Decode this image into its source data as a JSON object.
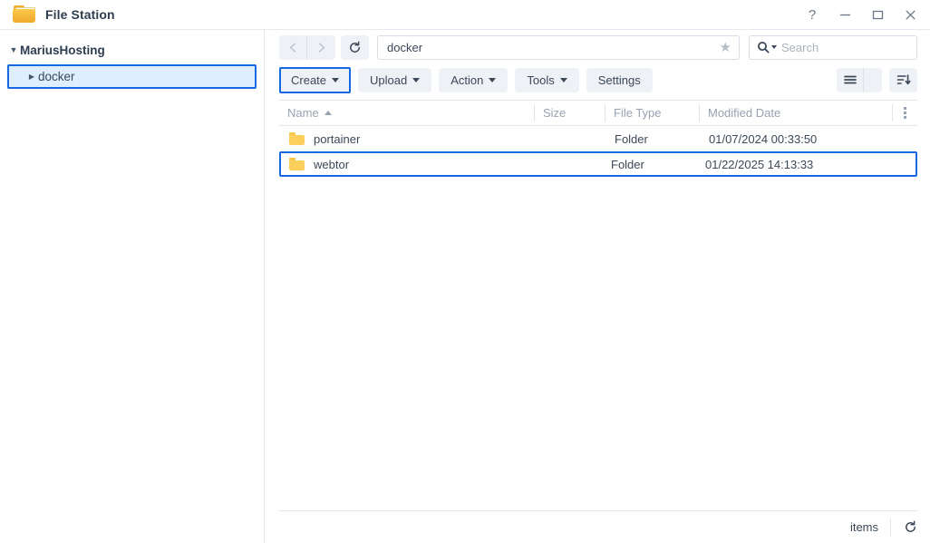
{
  "titlebar": {
    "app_title": "File Station",
    "app_icon": "folder-icon",
    "controls": {
      "help": "?",
      "minimize": "minimize-icon",
      "maximize": "maximize-icon",
      "close": "close-icon"
    }
  },
  "sidebar": {
    "root": {
      "label": "MariusHosting",
      "expanded": true
    },
    "items": [
      {
        "label": "docker",
        "selected": true,
        "expanded": false
      }
    ]
  },
  "navbar": {
    "back_icon": "chevron-left-icon",
    "forward_icon": "chevron-right-icon",
    "refresh_icon": "refresh-icon",
    "path_value": "docker",
    "favorite_icon": "star-icon",
    "search_icon": "search-icon",
    "search_placeholder": "Search",
    "search_value": ""
  },
  "toolbar": {
    "buttons": [
      {
        "label": "Create",
        "has_caret": true,
        "focused": true
      },
      {
        "label": "Upload",
        "has_caret": true,
        "focused": false
      },
      {
        "label": "Action",
        "has_caret": true,
        "focused": false
      },
      {
        "label": "Tools",
        "has_caret": true,
        "focused": false
      },
      {
        "label": "Settings",
        "has_caret": false,
        "focused": false
      }
    ],
    "view_mode_icon": "list-view-icon",
    "view_mode_caret_icon": "chevron-down-icon",
    "sort_icon": "sort-descending-icon"
  },
  "filelist": {
    "columns": [
      {
        "key": "name",
        "label": "Name",
        "sorted": "asc"
      },
      {
        "key": "size",
        "label": "Size"
      },
      {
        "key": "type",
        "label": "File Type"
      },
      {
        "key": "date",
        "label": "Modified Date"
      }
    ],
    "column_menu_icon": "kebab-menu-icon",
    "rows": [
      {
        "icon": "folder-icon",
        "name": "portainer",
        "size": "",
        "type": "Folder",
        "date": "01/07/2024 00:33:50",
        "selected": false
      },
      {
        "icon": "folder-icon",
        "name": "webtor",
        "size": "",
        "type": "Folder",
        "date": "01/22/2025 14:13:33",
        "selected": true
      }
    ]
  },
  "statusbar": {
    "items_label": "items",
    "refresh_icon": "refresh-icon"
  },
  "colors": {
    "accent": "#1469e0",
    "selection_bg": "#deeeff",
    "folder": "#fbcf5c",
    "button_bg": "#eef1f6",
    "text": "#3c4858",
    "muted_text": "#98a2b0"
  }
}
